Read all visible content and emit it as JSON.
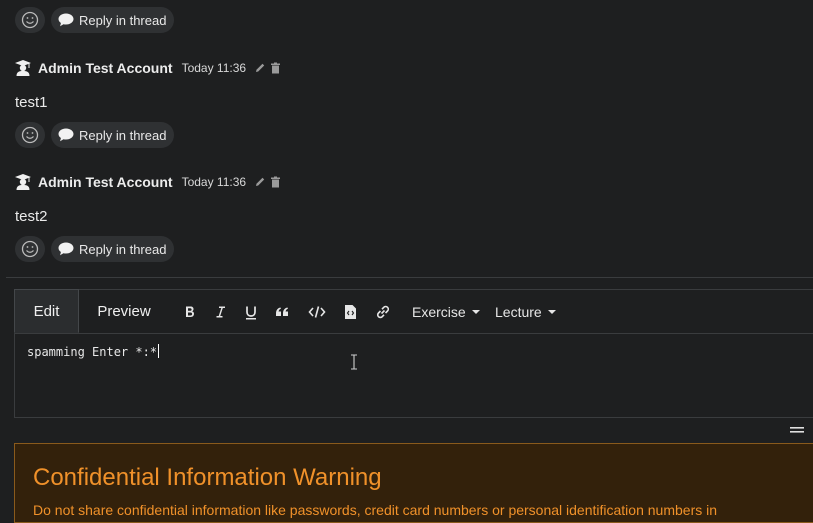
{
  "thread": {
    "reply_label": "Reply in thread",
    "messages": [
      {
        "author": "Admin Test Account",
        "time": "Today 11:36",
        "text": "test1"
      },
      {
        "author": "Admin Test Account",
        "time": "Today 11:36",
        "text": "test2"
      }
    ]
  },
  "editor": {
    "tabs": {
      "edit": "Edit",
      "preview": "Preview"
    },
    "toolbar": {
      "exercise": "Exercise",
      "lecture": "Lecture"
    },
    "content": "spamming Enter *:*"
  },
  "warning": {
    "title": "Confidential Information Warning",
    "body": "Do not share confidential information like passwords, credit card numbers or personal identification numbers in"
  },
  "colors": {
    "accent_warning": "#f0912a",
    "background": "#1e1f20"
  }
}
